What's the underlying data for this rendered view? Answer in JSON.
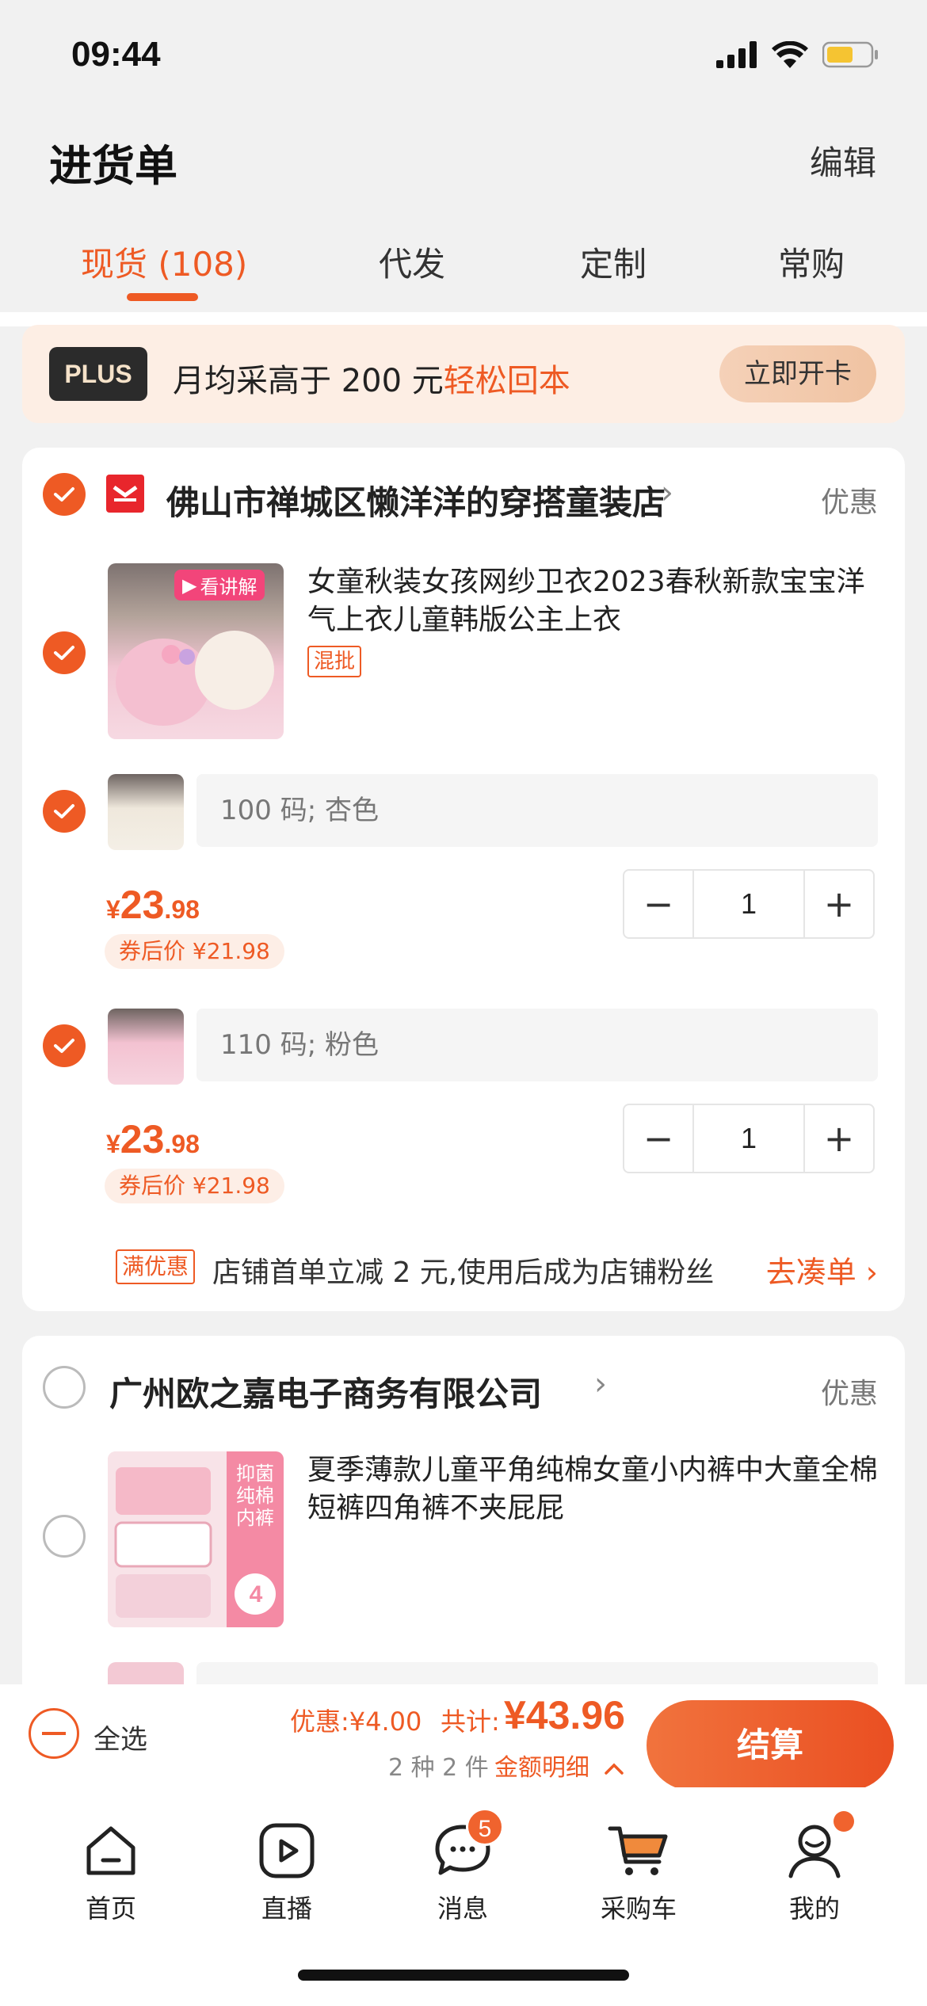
{
  "status": {
    "time": "09:44"
  },
  "header": {
    "title": "进货单",
    "edit": "编辑"
  },
  "tabs": [
    {
      "label": "现货 (108)",
      "active": true
    },
    {
      "label": "代发",
      "active": false
    },
    {
      "label": "定制",
      "active": false
    },
    {
      "label": "常购",
      "active": false
    }
  ],
  "plus_banner": {
    "logo": "PLUS",
    "text_prefix": "月均采高于 200 元",
    "text_highlight": "轻松回本",
    "cta": "立即开卡"
  },
  "stores": [
    {
      "name": "佛山市禅城区懒洋洋的穿搭童装店",
      "discount_link": "优惠",
      "checked": true,
      "product": {
        "video_tag": "看讲解",
        "title": "女童秋装女孩网纱卫衣2023春秋新款宝宝洋气上衣儿童韩版公主上衣",
        "tag": "混批",
        "checked": true,
        "skus": [
          {
            "spec": "100 码; 杏色",
            "currency": "¥",
            "price_int": "23",
            "price_dec": ".98",
            "coupon_price": "券后价 ¥21.98",
            "qty": "1",
            "checked": true
          },
          {
            "spec": "110 码; 粉色",
            "currency": "¥",
            "price_int": "23",
            "price_dec": ".98",
            "coupon_price": "券后价 ¥21.98",
            "qty": "1",
            "checked": true
          }
        ]
      },
      "promo": {
        "tag": "满优惠",
        "text": "店铺首单立减 2 元,使用后成为店铺粉丝",
        "link": "去凑单"
      }
    },
    {
      "name": "广州欧之嘉电子商务有限公司",
      "discount_link": "优惠",
      "checked": false,
      "product": {
        "title": "夏季薄款儿童平角纯棉女童小内裤中大童全棉短裤四角裤不夹屁屁",
        "thumb_label": "抑菌纯棉内裤",
        "thumb_count": "4",
        "checked": false
      }
    }
  ],
  "checkout": {
    "select_all": "全选",
    "discount": "优惠:¥4.00",
    "total_label": "共计:",
    "total_amount": "¥43.96",
    "count": "2 种 2 件",
    "detail": "金额明细",
    "button": "结算"
  },
  "nav": [
    {
      "label": "首页",
      "icon": "home-icon"
    },
    {
      "label": "直播",
      "icon": "live-icon"
    },
    {
      "label": "消息",
      "icon": "message-icon",
      "badge": "5"
    },
    {
      "label": "采购车",
      "icon": "cart-icon"
    },
    {
      "label": "我的",
      "icon": "profile-icon",
      "dot": true
    }
  ],
  "colors": {
    "accent": "#ee5a24",
    "background": "#f1f1f1"
  }
}
